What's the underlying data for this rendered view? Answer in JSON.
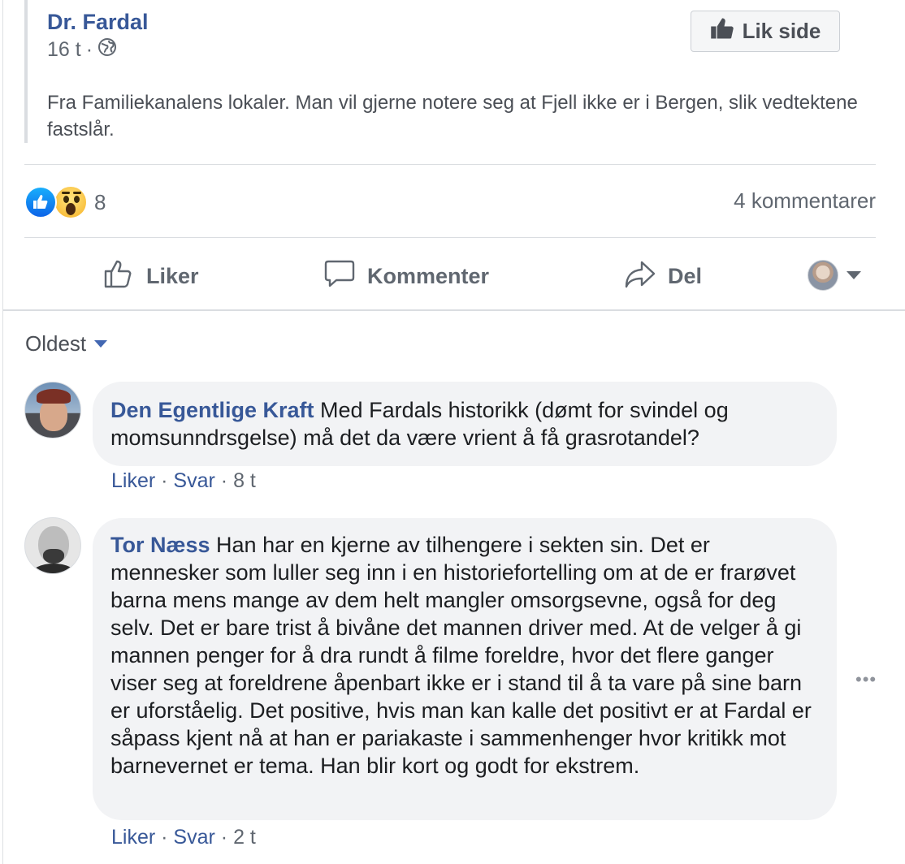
{
  "shared_post": {
    "author": "Dr. Fardal",
    "time": "16 t",
    "separator": "·",
    "text": "Fra Familiekanalens lokaler. Man vil gjerne notere seg at Fjell ikke er i Bergen, slik vedtektene fastslår.",
    "like_page_label": "Lik side"
  },
  "reactions": {
    "count": "8",
    "comments_count_label": "4 kommentarer"
  },
  "actions": {
    "like": "Liker",
    "comment": "Kommenter",
    "share": "Del"
  },
  "sort": {
    "label": "Oldest"
  },
  "comments": [
    {
      "name": "Den Egentlige Kraft",
      "text": "Med Fardals historikk (dømt for svindel og momsunndrsgelse) må det da være vrient å få grasrotandel?",
      "like_label": "Liker",
      "reply_label": "Svar",
      "time": "8 t"
    },
    {
      "name": "Tor Næss",
      "text": "Han har en kjerne av tilhengere i sekten sin. Det er mennesker som luller seg inn i en historiefortelling om at de er frarøvet barna mens mange av dem helt mangler omsorgsevne, også for deg selv. Det er bare trist å bivåne det mannen driver med. At de velger å gi mannen penger for å dra rundt å filme foreldre, hvor det flere ganger viser seg at foreldrene åpenbart ikke er i stand til å ta vare på sine barn er uforståelig. Det positive, hvis man kan kalle det positivt er at Fardal er såpass kjent nå at han er pariakaste i sammenhenger hvor kritikk mot barnevernet er tema. Han blir kort og godt for ekstrem.",
      "like_label": "Liker",
      "reply_label": "Svar",
      "time": "2 t"
    }
  ],
  "more_label": "•••",
  "colors": {
    "link": "#385898",
    "secondary_text": "#606770",
    "bubble_bg": "#f2f3f5",
    "divider": "#dadde1"
  },
  "icons": [
    "globe-icon",
    "thumbs-up-icon",
    "like-reaction-icon",
    "wow-reaction-icon",
    "comment-icon",
    "share-icon",
    "chevron-down-icon",
    "more-options-icon"
  ]
}
